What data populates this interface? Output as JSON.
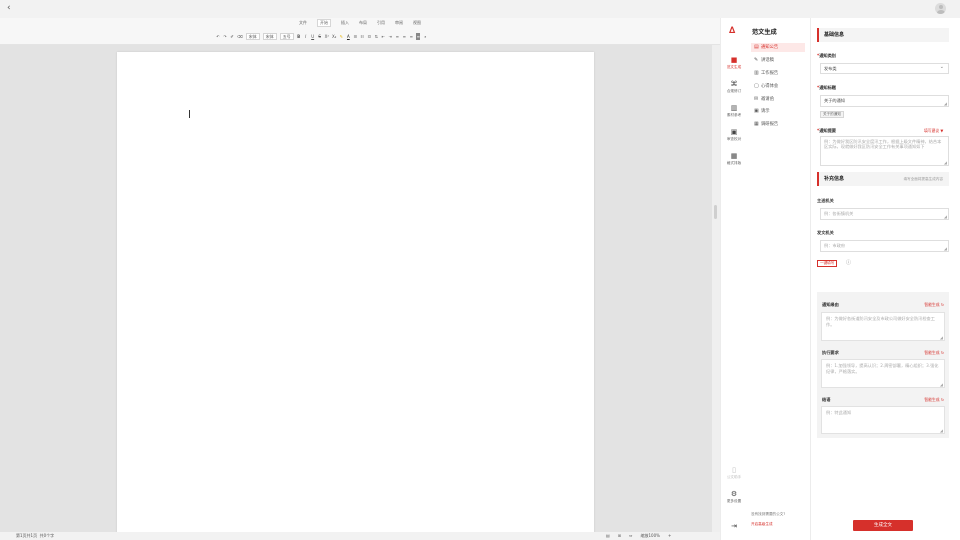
{
  "topbar": {
    "back_icon": "chevron-left-icon",
    "avatar_icon": "user-avatar-icon"
  },
  "menubar": {
    "items": [
      "文件",
      "开始",
      "插入",
      "布局",
      "引用",
      "审阅",
      "视图"
    ],
    "active_index": 1
  },
  "toolbar": {
    "font_name": "宋体",
    "font_family": "宋体",
    "font_size": "五号"
  },
  "statusbar": {
    "page_info": "第1页共1页",
    "word_count": "共0个字",
    "zoom": "缩放100%"
  },
  "rail": {
    "logo_icon": "brand-logo-icon",
    "items": [
      {
        "label": "范文生成",
        "icon": "document-gen-icon"
      },
      {
        "label": "合规修订",
        "icon": "compliance-icon"
      },
      {
        "label": "素材参考",
        "icon": "library-icon"
      },
      {
        "label": "审查校对",
        "icon": "proofread-icon"
      },
      {
        "label": "格式排版",
        "icon": "format-icon"
      }
    ],
    "bottom": [
      {
        "label": "公文助手",
        "icon": "assistant-icon"
      },
      {
        "label": "更多设置",
        "icon": "settings-icon"
      }
    ]
  },
  "category_nav": {
    "title": "范文生成",
    "items": [
      {
        "label": "通知公告",
        "icon": "notice-icon"
      },
      {
        "label": "讲话稿",
        "icon": "speech-icon"
      },
      {
        "label": "工作报告",
        "icon": "report-icon"
      },
      {
        "label": "心得体会",
        "icon": "insight-icon"
      },
      {
        "label": "邀请函",
        "icon": "invitation-icon"
      },
      {
        "label": "请示",
        "icon": "request-icon"
      },
      {
        "label": "调研报告",
        "icon": "research-icon"
      }
    ],
    "footer_question": "没有找到需要的公文?",
    "footer_link": "开启高级生成"
  },
  "form": {
    "basic_section": "基础信息",
    "notice_type_label": "通知类别",
    "notice_type_value": "发布类",
    "notice_title_label": "通知标题",
    "notice_title_value": "关于的通知",
    "tag_label": "关于的通知",
    "summary_label": "通知提要",
    "summary_tip": "填写建议",
    "summary_placeholder": "例：为做好我区防汛安全度汛工作，根据上级文件精神，结合本区实际，现就做好我区防汛安全工作有关事项通知如下",
    "more_section": "补充信息",
    "more_hint": "填写全面将提高生成内容",
    "issuer_label": "主送机关",
    "issuer_placeholder": "例：各街镇机关",
    "sender_label": "发文机关",
    "sender_placeholder": "例：市政府",
    "collapse_tag": "一键填写",
    "info_icon": "info-icon",
    "panels": [
      {
        "label": "通知缘由",
        "gen": "智能生成",
        "placeholder": "例：为做好各街道防汛安全及市政公司做好安全防汛检查工作。"
      },
      {
        "label": "执行要求",
        "gen": "智能生成",
        "placeholder": "例：1.加强领导，提高认识；2.周密部署，精心组织；3.强化纪律，严格落实。"
      },
      {
        "label": "结语",
        "gen": "智能生成",
        "placeholder": "例：特此通知"
      }
    ],
    "generate_button": "生成全文"
  }
}
